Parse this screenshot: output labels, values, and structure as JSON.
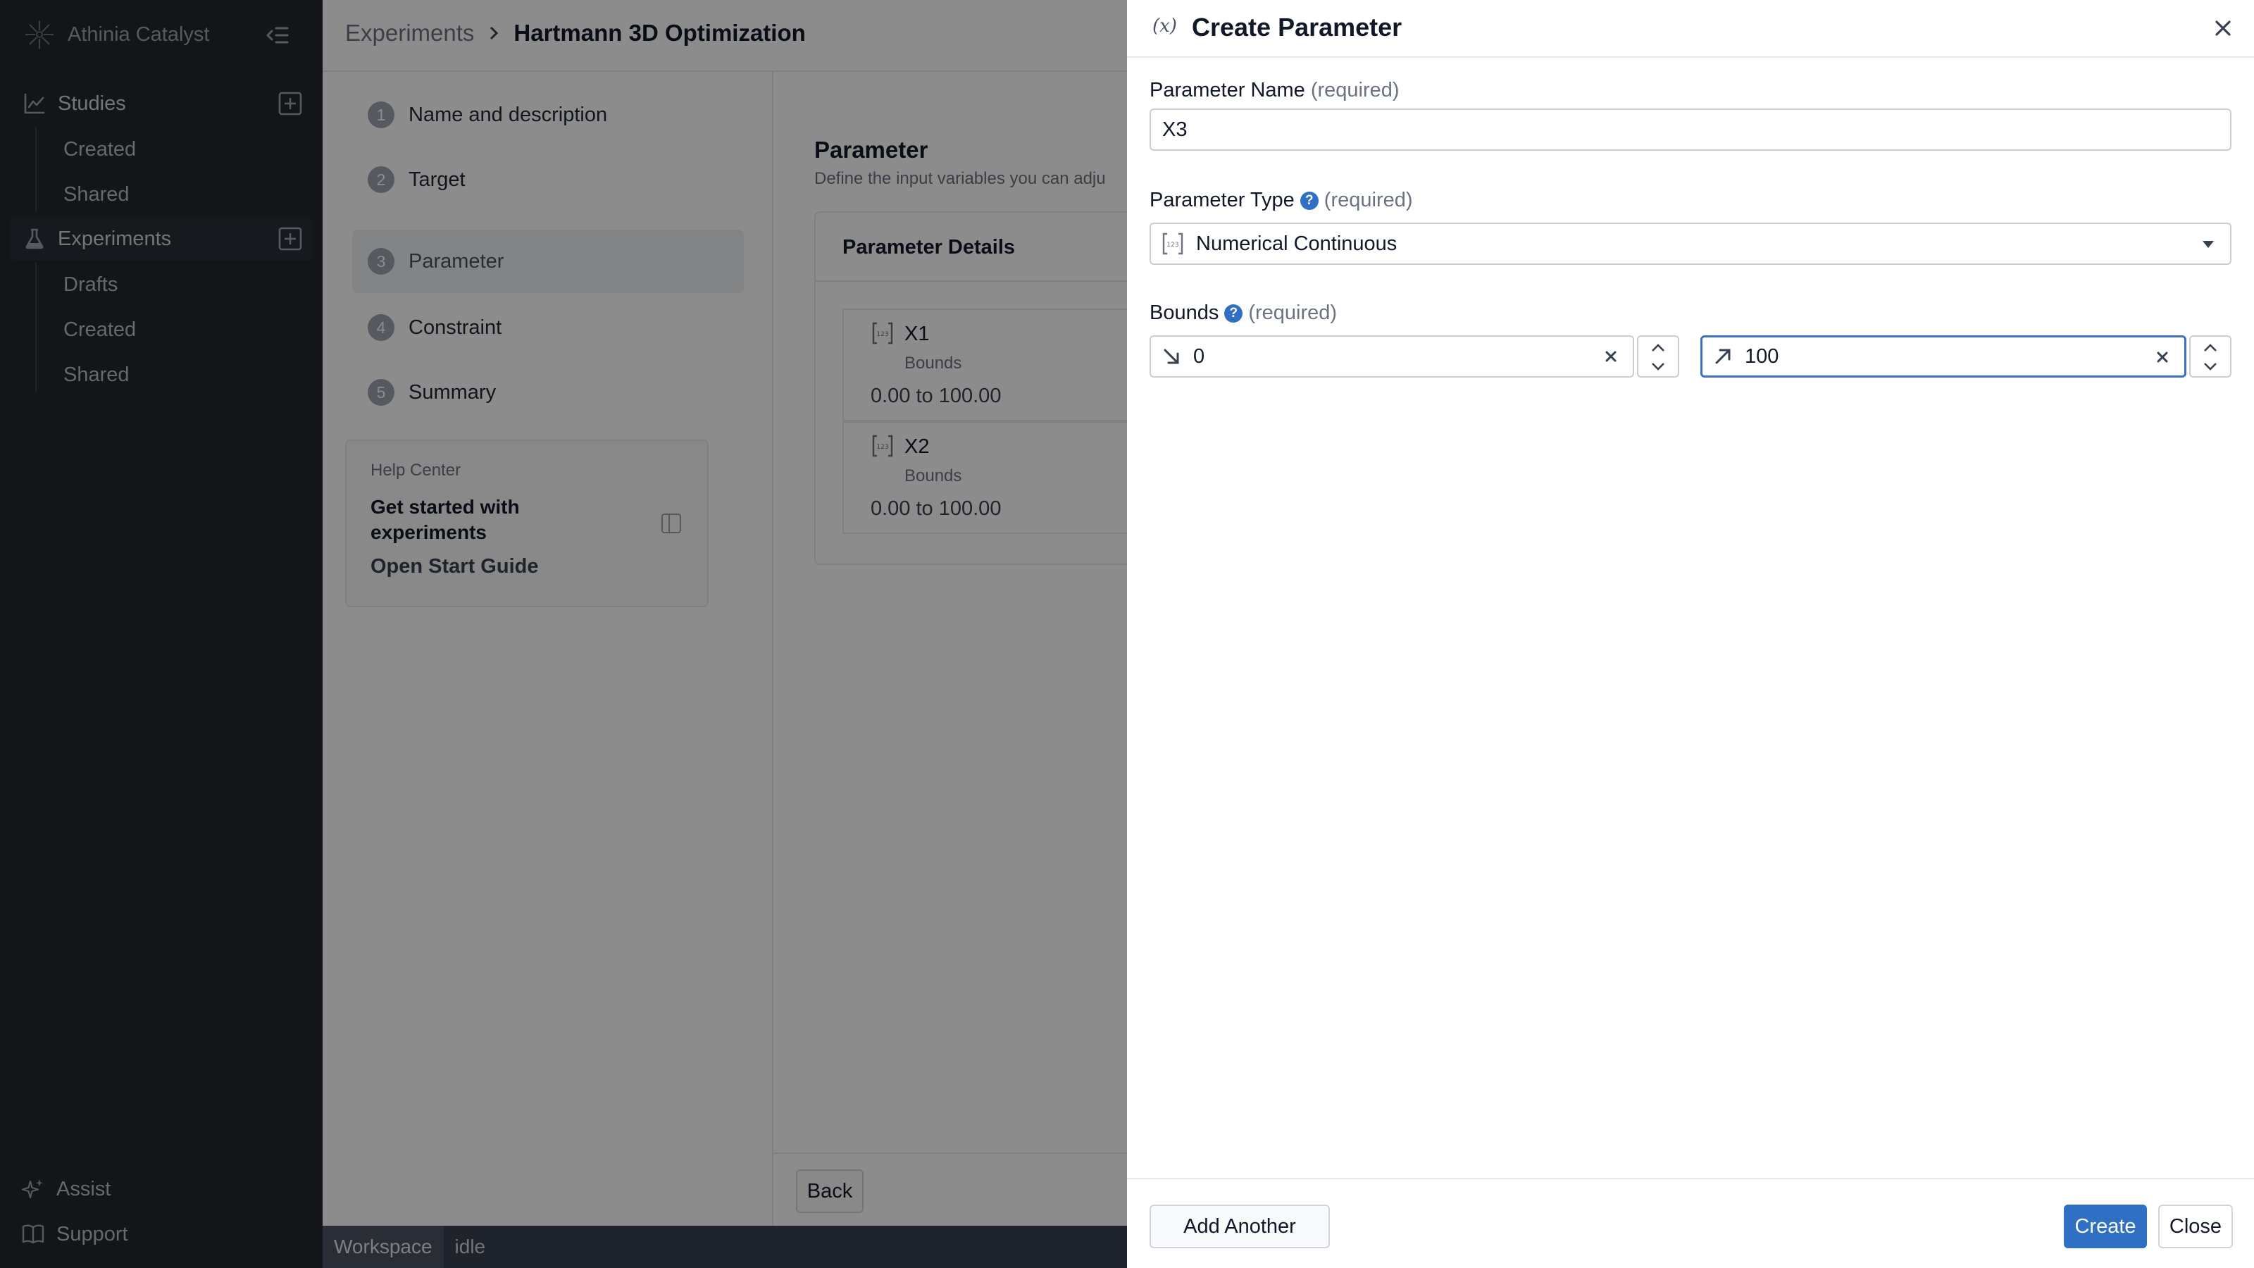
{
  "sidebar": {
    "brand": "Athinia Catalyst",
    "studies": {
      "label": "Studies",
      "items": [
        "Created",
        "Shared"
      ]
    },
    "experiments": {
      "label": "Experiments",
      "items": [
        "Drafts",
        "Created",
        "Shared"
      ]
    },
    "assist": "Assist",
    "support": "Support"
  },
  "page": {
    "breadcrumb": {
      "root": "Experiments",
      "current": "Hartmann 3D Optimization"
    },
    "steps": [
      {
        "num": "1",
        "label": "Name and description"
      },
      {
        "num": "2",
        "label": "Target"
      },
      {
        "num": "3",
        "label": "Parameter"
      },
      {
        "num": "4",
        "label": "Constraint"
      },
      {
        "num": "5",
        "label": "Summary"
      }
    ],
    "help": {
      "title": "Help Center",
      "heading": "Get started with experiments",
      "link": "Open Start Guide"
    },
    "section_title": "Parameter",
    "section_subtitle": "Define the input variables you can adju",
    "details_title": "Parameter Details",
    "params": [
      {
        "name": "X1",
        "bounds_label": "Bounds",
        "range": "0.00 to 100.00"
      },
      {
        "name": "X2",
        "bounds_label": "Bounds",
        "range": "0.00 to 100.00"
      }
    ],
    "back": "Back",
    "status": {
      "workspace": "Workspace",
      "state": "idle"
    }
  },
  "dialog": {
    "icon_text": "(x)",
    "title": "Create Parameter",
    "name_label": "Parameter Name",
    "required": "(required)",
    "name_value": "X3",
    "type_label": "Parameter Type",
    "type_value": "Numerical Continuous",
    "bounds_label": "Bounds",
    "lower": "0",
    "upper": "100",
    "add_another": "Add Another",
    "create": "Create",
    "close": "Close"
  },
  "colors": {
    "sidebar_bg": "#24272e",
    "primary": "#2f6fc4",
    "focus": "#3b6fc0"
  }
}
